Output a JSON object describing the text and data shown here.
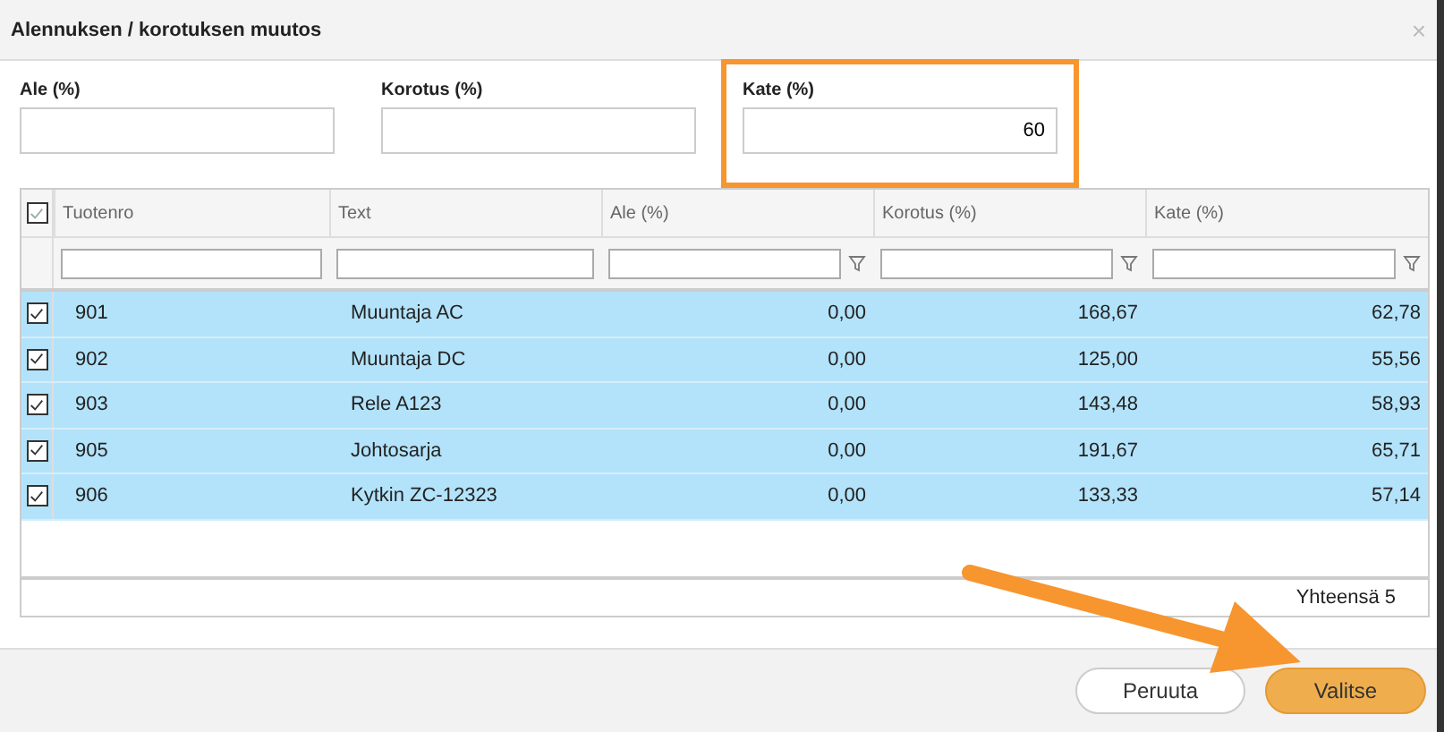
{
  "window": {
    "title": "Alennuksen / korotuksen muutos",
    "close": "×"
  },
  "fields": [
    {
      "label": "Ale (%)",
      "highlighted": false
    },
    {
      "label": "Korotus (%)",
      "highlighted": false
    },
    {
      "label": "Kate (%)",
      "value": "60",
      "highlighted": true
    }
  ],
  "table": {
    "all_checked": true,
    "columns": [
      {
        "label": "Tuotenro",
        "filter_icon": false,
        "kind": "text"
      },
      {
        "label": "Text",
        "filter_icon": false,
        "kind": "text"
      },
      {
        "label": "Ale (%)",
        "filter_icon": true,
        "kind": "number"
      },
      {
        "label": "Korotus (%)",
        "filter_icon": true,
        "kind": "number"
      },
      {
        "label": "Kate (%)",
        "filter_icon": true,
        "kind": "number"
      }
    ],
    "rows": [
      {
        "checked": true,
        "selected": true,
        "cells": [
          "901",
          "Muuntaja AC",
          "0,00",
          "168,67",
          "62,78"
        ]
      },
      {
        "checked": true,
        "selected": true,
        "cells": [
          "902",
          "Muuntaja DC",
          "0,00",
          "125,00",
          "55,56"
        ]
      },
      {
        "checked": true,
        "selected": true,
        "cells": [
          "903",
          "Rele A123",
          "0,00",
          "143,48",
          "58,93"
        ]
      },
      {
        "checked": true,
        "selected": true,
        "cells": [
          "905",
          "Johtosarja",
          "0,00",
          "191,67",
          "65,71"
        ]
      },
      {
        "checked": true,
        "selected": true,
        "cells": [
          "906",
          "Kytkin ZC-12323",
          "0,00",
          "133,33",
          "57,14"
        ]
      }
    ],
    "footer": "Yhteensä 5"
  },
  "buttons": [
    {
      "label": "Peruuta",
      "kind": "secondary"
    },
    {
      "label": "Valitse",
      "kind": "primary"
    }
  ],
  "annotation_arrow": true
}
